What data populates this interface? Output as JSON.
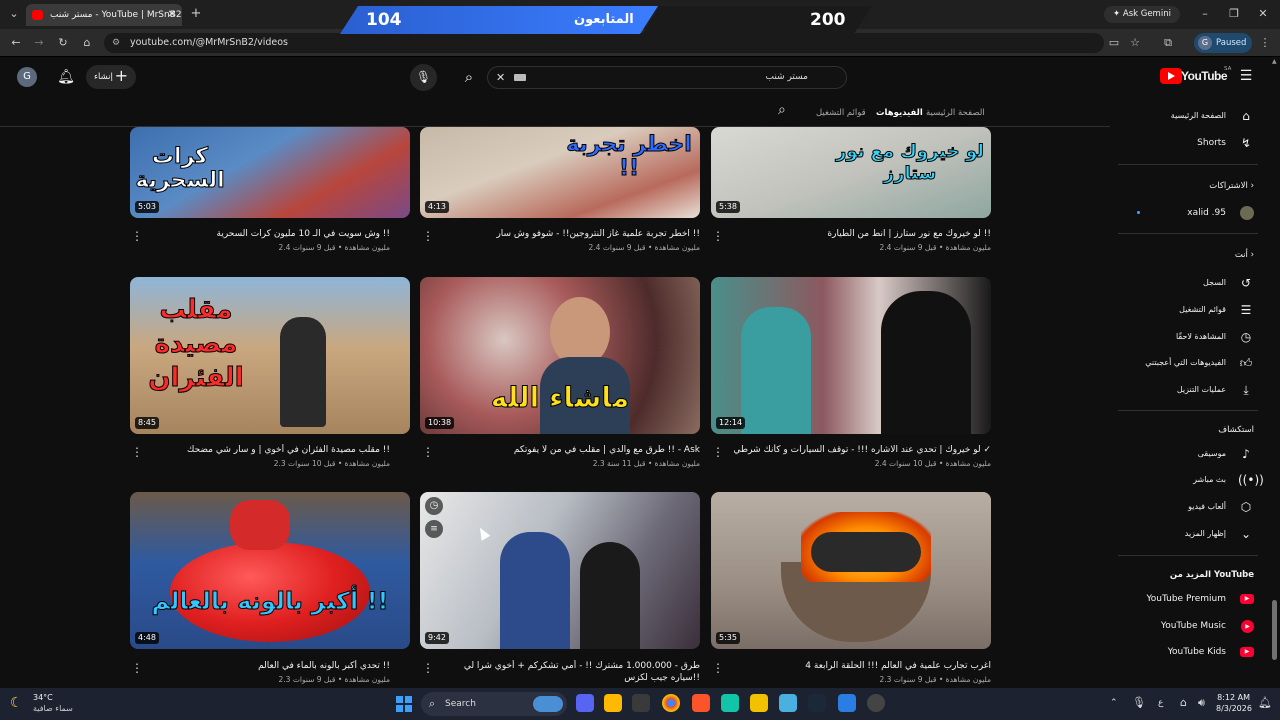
{
  "browser": {
    "tab_title": "مستر شنب - YouTube | MrSnB2",
    "url": "youtube.com/@MrMrSnB2/videos",
    "ask_gemini": "Ask Gemini",
    "profile_letter": "G",
    "profile_status": "Paused"
  },
  "overlay": {
    "left_score": "104",
    "label": "المتابعون",
    "right_score": "200"
  },
  "header": {
    "create_label": "إنشاء",
    "avatar_letter": "G",
    "search_value": "مستر شنب",
    "logo_text": "YouTube",
    "region": "SA"
  },
  "channel_tabs": {
    "home": "الصفحة الرئيسية",
    "videos": "الفيديوهات",
    "playlists": "قوائم التشغيل"
  },
  "videos": [
    {
      "title": "وش سويت في الـ 10 مليون كرات السحرية !!",
      "meta": "2.4 مليون مشاهدة • قبل 9 سنوات",
      "duration": "5:03",
      "overlay": "كرات السحرية",
      "overlay_color": "#ffffff"
    },
    {
      "title": "اخطر تجربة علمية غاز النتروجين!! - شوفو وش سار !!",
      "meta": "2.4 مليون مشاهدة • قبل 9 سنوات",
      "duration": "4:13",
      "overlay": "اخطر تجربة !!",
      "overlay_color": "#2f6bff"
    },
    {
      "title": "لو خيروك مع نور ستارز | انط من الطيارة !!",
      "meta": "2.4 مليون مشاهدة • قبل 9 سنوات",
      "duration": "5:38",
      "overlay": "لو خيروك مع نور ستارز",
      "overlay_color": "#36d7ff"
    },
    {
      "title": "مقلب مصيدة الفئران في أخوي | و سار شي مضحك !!",
      "meta": "2.3 مليون مشاهدة • قبل 10 سنوات",
      "duration": "8:45",
      "overlay": "مقلب مصيدة الفئران",
      "overlay_color": "#ff2a2a"
    },
    {
      "title": "طرق مع والدي | مقلب في من لا يفوتكم !! - Ask",
      "meta": "2.3 مليون مشاهدة • قبل 11 سنة",
      "duration": "10:38",
      "overlay": "ماشاء الله",
      "overlay_color": "#ffe11a"
    },
    {
      "title": "لو خيروك | تحدي عند الاشاره !!! - توقف السيارات و كأنك شرطي ✓",
      "meta": "2.4 مليون مشاهدة • قبل 10 سنوات",
      "duration": "12:14",
      "overlay": "",
      "overlay_color": "#ffffff"
    },
    {
      "title": "تحدي أكبر بالونه بالماء في العالم !!",
      "meta": "2.3 مليون مشاهدة • قبل 9 سنوات",
      "duration": "4:48",
      "overlay": "أكبر بالونه بالعالم !!",
      "overlay_color": "#33c6ff"
    },
    {
      "title": "طرق - 1.000.000 مشترك !! - أمي تشكركم + أخوي شرا لي سياره جيب لكزس!!",
      "meta": "2.3 مليون مشاهدة • قبل 9 سنوات",
      "duration": "9:42",
      "overlay": "",
      "overlay_color": "#ffffff"
    },
    {
      "title": "اغرب تجارب علمية في العالم !!! الحلقة الرابعة 4",
      "meta": "2.3 مليون مشاهدة • قبل 9 سنوات",
      "duration": "5:35",
      "overlay": "",
      "overlay_color": "#ffffff"
    }
  ],
  "sidebar": {
    "home": "الصفحة الرئيسية",
    "shorts": "Shorts",
    "subs_head": "الاشتراكات",
    "sub1": "xalid .95",
    "you_head": "أنت",
    "history": "السجل",
    "playlists": "قوائم التشغيل",
    "watch_later": "المشاهدة لاحقًا",
    "liked": "الفيديوهات التي أعجبتني",
    "downloads": "عمليات التنزيل",
    "explore_head": "استكشاف",
    "music": "موسيقى",
    "live": "بث مباشر",
    "gaming": "ألعاب فيديو",
    "more": "إظهار المزيد",
    "more_head": "المزيد من YouTube",
    "premium": "YouTube Premium",
    "yt_music": "YouTube Music",
    "kids": "YouTube Kids"
  },
  "taskbar": {
    "temp": "34°C",
    "weather": "سماء صافية",
    "search": "Search",
    "time": "8:12 AM",
    "date": "8/3/2026",
    "lang": "ع"
  }
}
